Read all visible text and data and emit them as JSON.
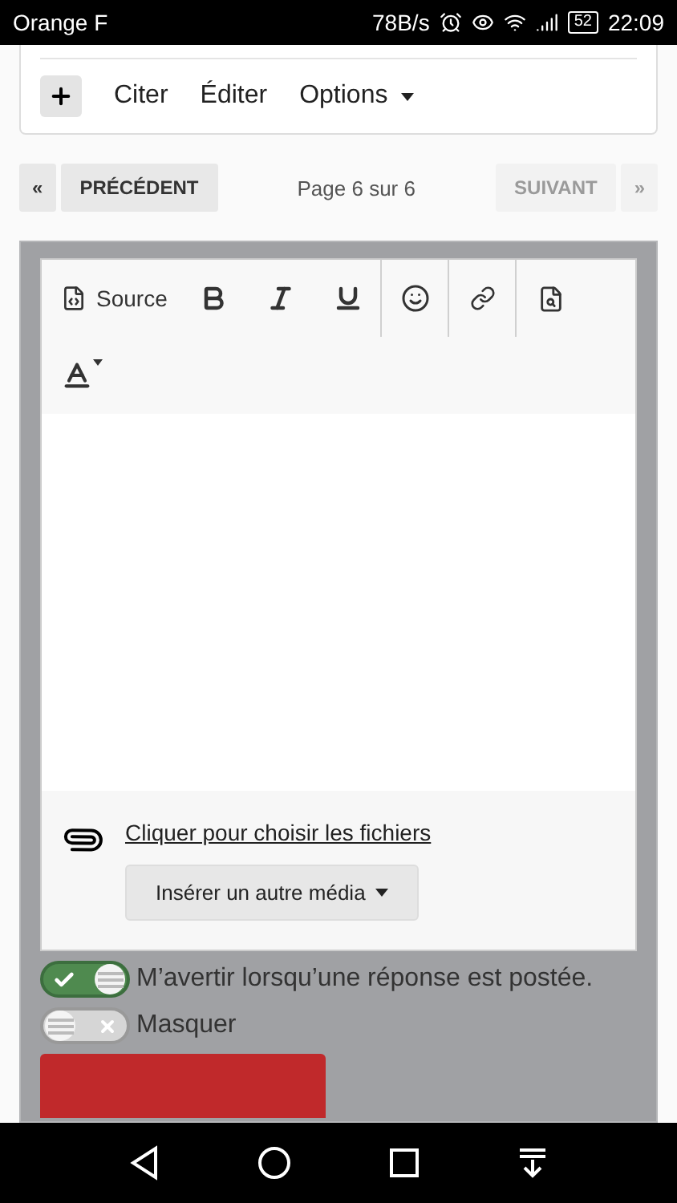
{
  "status_bar": {
    "carrier": "Orange F",
    "speed": "78B/s",
    "battery": "52",
    "time": "22:09"
  },
  "post_actions": {
    "items": [
      {
        "label": "Citer",
        "kind": "link"
      },
      {
        "label": "Éditer",
        "kind": "link"
      },
      {
        "label": "Options",
        "kind": "menu"
      }
    ]
  },
  "pagination": {
    "first": {
      "label": "«",
      "disabled": false
    },
    "previous": {
      "label": "PRÉCÉDENT",
      "disabled": false
    },
    "info": "Page 6 sur 6",
    "next": {
      "label": "SUIVANT",
      "disabled": true
    },
    "last": {
      "label": "»",
      "disabled": true
    }
  },
  "editor": {
    "toolbar": [
      {
        "kind": "source",
        "label": "Source"
      },
      {
        "kind": "bold"
      },
      {
        "kind": "italic"
      },
      {
        "kind": "underline",
        "separator_after": true
      },
      {
        "kind": "emoji",
        "separator_after": true
      },
      {
        "kind": "link",
        "separator_after": true
      },
      {
        "kind": "preview"
      },
      {
        "kind": "color"
      }
    ],
    "attach_link": "Cliquer pour choisir les fichiers",
    "media_button": "Insérer un autre média"
  },
  "toggles": [
    {
      "label": "M’avertir lorsqu’une réponse est postée.",
      "on": true
    },
    {
      "label": "Masquer",
      "on": false
    }
  ]
}
